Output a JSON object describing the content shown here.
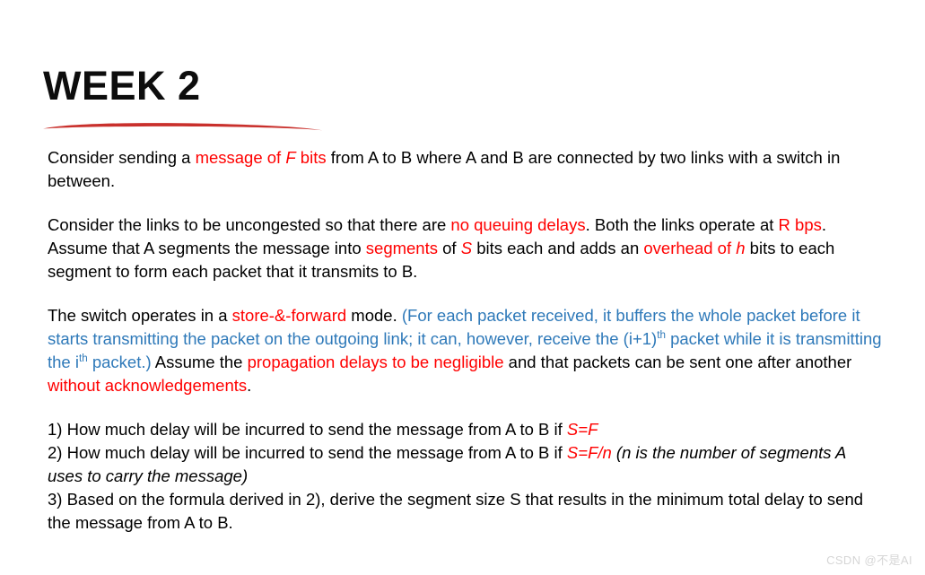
{
  "colors": {
    "red_text": "#ff0000",
    "blue_text": "#2e79b9",
    "underline_stroke": "#c9302c",
    "title": "#0d0d0d",
    "watermark": "#d6d6d6",
    "background": "#ffffff"
  },
  "title": "WEEK 2",
  "watermark": "CSDN @不是AI",
  "paragraphs": [
    {
      "id": "p1",
      "tokens": [
        {
          "t": "Consider sending a "
        },
        {
          "t": "message of ",
          "c": "red"
        },
        {
          "t": "F",
          "c": "red",
          "i": true
        },
        {
          "t": " bits",
          "c": "red"
        },
        {
          "t": " from A to B where A and B are connected by two links with a switch in between."
        }
      ]
    },
    {
      "id": "p2",
      "tokens": [
        {
          "t": "Consider the links to be uncongested so that there are "
        },
        {
          "t": "no queuing delays",
          "c": "red"
        },
        {
          "t": ". Both the links operate at "
        },
        {
          "t": "R bps",
          "c": "red"
        },
        {
          "t": ". Assume that A segments the message into "
        },
        {
          "t": "segments",
          "c": "red"
        },
        {
          "t": " of "
        },
        {
          "t": "S",
          "c": "red",
          "i": true
        },
        {
          "t": " bits each and adds an "
        },
        {
          "t": "overhead of ",
          "c": "red"
        },
        {
          "t": "h",
          "c": "red",
          "i": true
        },
        {
          "t": " bits to each segment to form each packet that it transmits to B."
        }
      ]
    },
    {
      "id": "p3",
      "tokens": [
        {
          "t": "The switch operates in a "
        },
        {
          "t": "store-&-forward",
          "c": "red"
        },
        {
          "t": " mode. "
        },
        {
          "t": "(For each packet received, it buffers the whole packet before it starts transmitting the packet on the outgoing link; it can, however, receive the (i+1)",
          "c": "blue"
        },
        {
          "t": "th",
          "c": "blue",
          "sup": true
        },
        {
          "t": " packet while it is transmitting the i",
          "c": "blue"
        },
        {
          "t": "th",
          "c": "blue",
          "sup": true
        },
        {
          "t": " packet.)",
          "c": "blue"
        },
        {
          "t": " Assume the "
        },
        {
          "t": "propagation delays to be negligible",
          "c": "red"
        },
        {
          "t": " and that packets can be sent one after another "
        },
        {
          "t": "without acknowledgements",
          "c": "red"
        },
        {
          "t": "."
        }
      ]
    },
    {
      "id": "p4",
      "tokens": [
        {
          "t": "1) How much delay will be incurred to send the message from A to B if "
        },
        {
          "t": "S=F",
          "c": "red",
          "i": true
        },
        {
          "t": "\n"
        },
        {
          "t": "2) How much delay will be incurred to send the message from A to B if "
        },
        {
          "t": "S=F/n",
          "c": "red",
          "i": true
        },
        {
          "t": " (n is the number of segments A uses to carry the message)",
          "i": true
        },
        {
          "t": "\n"
        },
        {
          "t": "3) Based on the formula derived in 2), derive the segment size S that results in the minimum total delay to send the message from A to B."
        }
      ]
    }
  ]
}
